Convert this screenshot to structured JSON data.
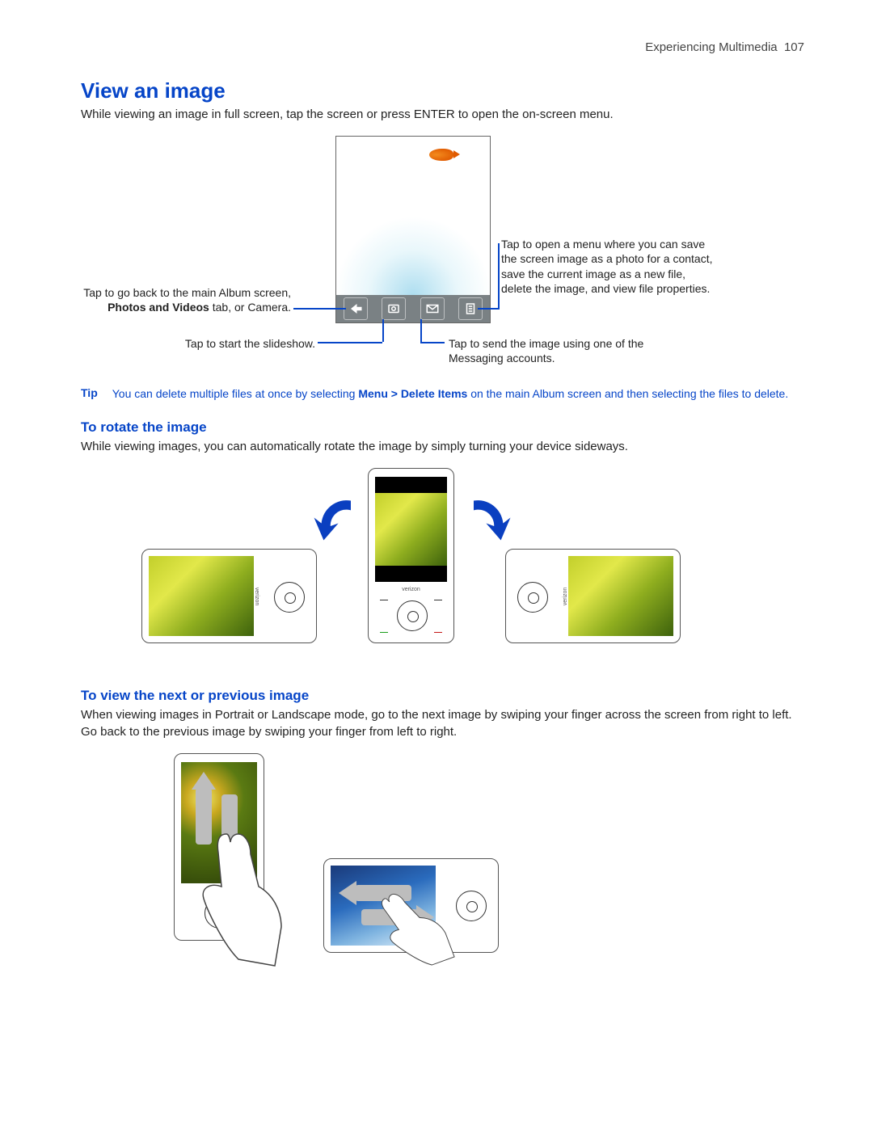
{
  "header": {
    "section": "Experiencing Multimedia",
    "page_number": "107"
  },
  "h1": "View an image",
  "intro": "While viewing an image in full screen, tap the screen or press ENTER to open the on-screen menu.",
  "callouts": {
    "back_pre": "Tap to go back to the main Album screen, ",
    "back_bold": "Photos and Videos",
    "back_post": " tab, or Camera.",
    "slideshow": "Tap to start the slideshow.",
    "send": "Tap to send the image using one of the Messaging accounts.",
    "menu": "Tap to open a menu where you can save the screen image as a photo for a contact, save the current image as a new file, delete the image, and view file properties."
  },
  "toolbar_icons": {
    "back": "back-arrow-icon",
    "slideshow": "slideshow-icon",
    "send": "envelope-icon",
    "menu": "document-icon"
  },
  "tip": {
    "label": "Tip",
    "pre": "You can delete multiple files at once by selecting ",
    "bold": "Menu > Delete Items",
    "post": " on the main Album screen and then selecting the files to delete."
  },
  "h2_rotate": "To rotate the image",
  "rotate_body": "While viewing images, you can automatically rotate the image by simply turning your device sideways.",
  "brand": "verizon",
  "h2_swipe": "To view the next or previous image",
  "swipe_body": "When viewing images in Portrait or Landscape mode, go to the next image by swiping your finger across the screen from right to left. Go back to the previous image by swiping your finger from left to right."
}
